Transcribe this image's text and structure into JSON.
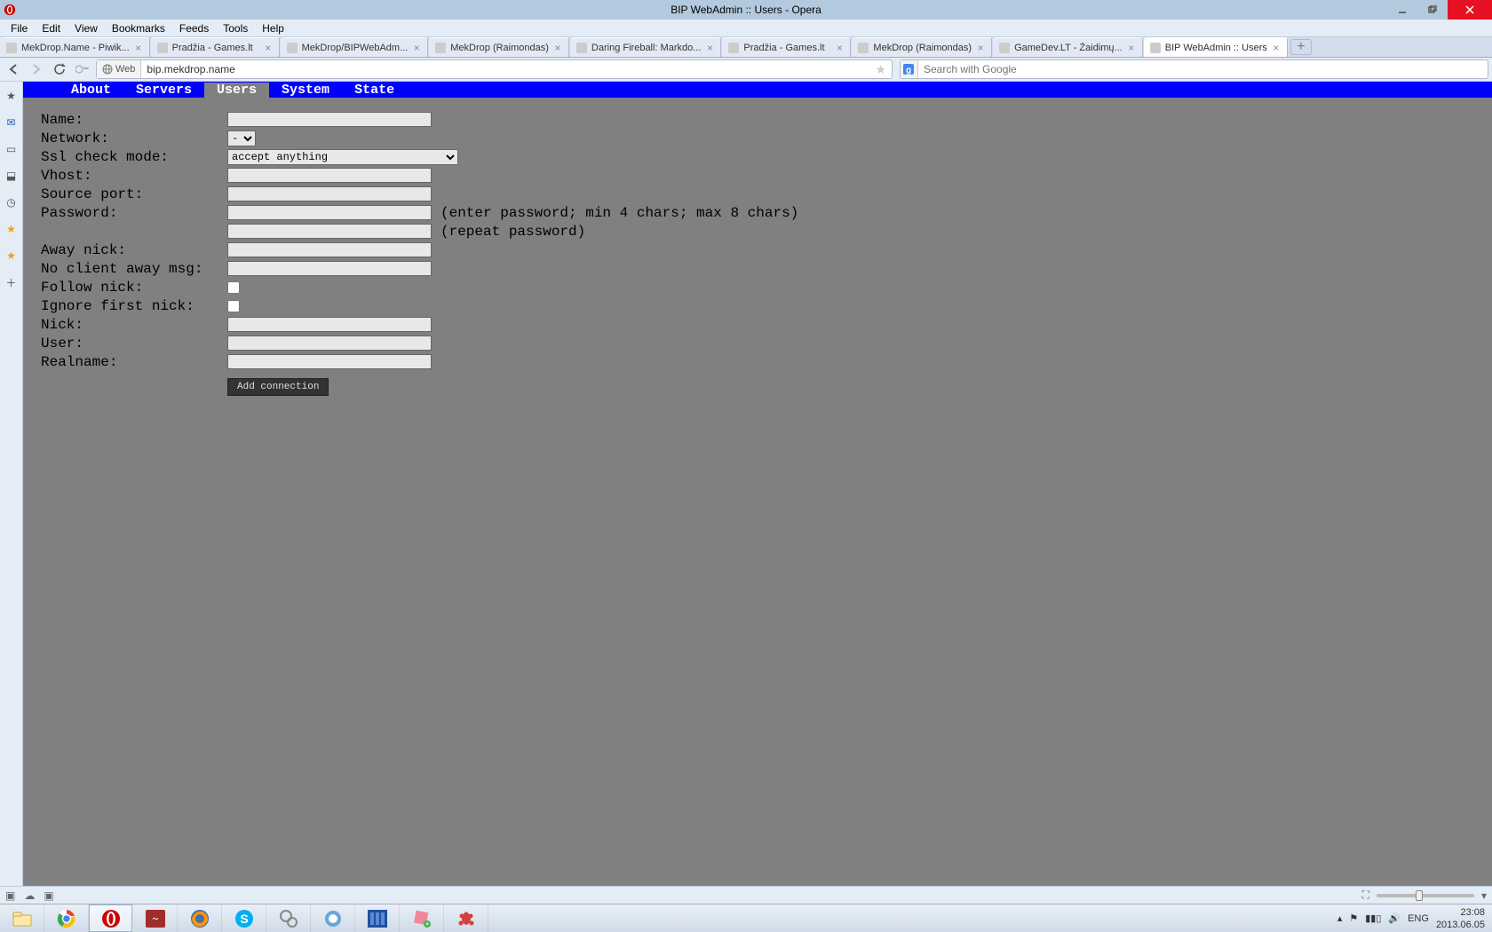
{
  "window": {
    "title": "BIP WebAdmin :: Users - Opera"
  },
  "menu": [
    "File",
    "Edit",
    "View",
    "Bookmarks",
    "Feeds",
    "Tools",
    "Help"
  ],
  "tabs": [
    {
      "label": "MekDrop.Name - Piwik...",
      "active": false
    },
    {
      "label": "Pradžia - Games.lt",
      "active": false
    },
    {
      "label": "MekDrop/BIPWebAdm...",
      "active": false
    },
    {
      "label": "MekDrop (Raimondas)",
      "active": false
    },
    {
      "label": "Daring Fireball: Markdo...",
      "active": false
    },
    {
      "label": "Pradžia - Games.lt",
      "active": false
    },
    {
      "label": "MekDrop (Raimondas)",
      "active": false
    },
    {
      "label": "GameDev.LT - Žaidimų...",
      "active": false
    },
    {
      "label": "BIP WebAdmin :: Users",
      "active": true
    }
  ],
  "address": {
    "badge": "Web",
    "url": "bip.mekdrop.name",
    "search_placeholder": "Search with Google"
  },
  "page_nav": {
    "items": [
      "About",
      "Servers",
      "Users",
      "System",
      "State"
    ],
    "active": "Users"
  },
  "form": {
    "labels": {
      "name": "Name:",
      "network": "Network:",
      "ssl": "Ssl check mode:",
      "vhost": "Vhost:",
      "source_port": "Source port:",
      "password": "Password:",
      "away_nick": "Away nick:",
      "no_client_away_msg": "No client away msg:",
      "follow_nick": "Follow nick:",
      "ignore_first_nick": "Ignore first nick:",
      "nick": "Nick:",
      "user": "User:",
      "realname": "Realname:"
    },
    "ssl_value": "accept anything",
    "network_value": "-",
    "password_hint1": "(enter password; min 4 chars; max 8 chars)",
    "password_hint2": "(repeat password)",
    "submit": "Add connection"
  },
  "systray": {
    "lang": "ENG",
    "time": "23:08",
    "date": "2013.06.05"
  }
}
